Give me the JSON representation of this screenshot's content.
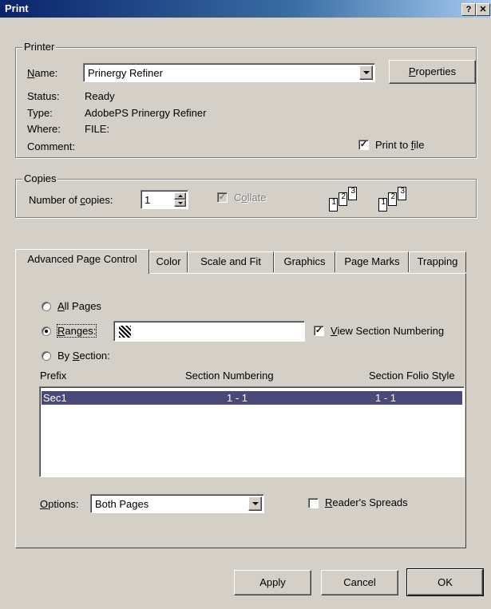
{
  "window": {
    "title": "Print",
    "help_button": "?",
    "close_button": "✕"
  },
  "printer": {
    "group_label": "Printer",
    "name_label": "Name:",
    "name_value": "Prinergy Refiner",
    "properties_button": "Properties",
    "status_label": "Status:",
    "status_value": "Ready",
    "type_label": "Type:",
    "type_value": "AdobePS Prinergy Refiner",
    "where_label": "Where:",
    "where_value": "FILE:",
    "comment_label": "Comment:",
    "print_to_file_label": "Print to file",
    "print_to_file_checked": true
  },
  "copies": {
    "group_label": "Copies",
    "number_label": "Number of copies:",
    "number_value": "1",
    "collate_label": "Collate",
    "collate_checked": true,
    "collate_enabled": false,
    "page_labels": [
      "1",
      "2",
      "3"
    ]
  },
  "tabs": [
    {
      "label": "Advanced Page Control",
      "active": true
    },
    {
      "label": "Color",
      "active": false
    },
    {
      "label": "Scale and Fit",
      "active": false
    },
    {
      "label": "Graphics",
      "active": false
    },
    {
      "label": "Page Marks",
      "active": false
    },
    {
      "label": "Trapping",
      "active": false
    }
  ],
  "page_control": {
    "all_pages_label": "All Pages",
    "ranges_label": "Ranges:",
    "ranges_value": "",
    "by_section_label": "By Section:",
    "selected_option": "ranges",
    "view_section_numbering_label": "View Section Numbering",
    "view_section_numbering_checked": true,
    "columns": [
      "Prefix",
      "Section Numbering",
      "Section Folio Style"
    ],
    "rows": [
      {
        "prefix": "Sec1",
        "numbering": "1 - 1",
        "folio": "1 - 1",
        "selected": true
      }
    ],
    "options_label": "Options:",
    "options_value": "Both Pages",
    "readers_spreads_label": "Reader's Spreads",
    "readers_spreads_checked": false
  },
  "buttons": {
    "apply": "Apply",
    "cancel": "Cancel",
    "ok": "OK"
  },
  "colors": {
    "titlebar_start": "#0a246a",
    "titlebar_end": "#a6caf0",
    "selection": "#4a4a7a",
    "face": "#d4d0c8"
  }
}
